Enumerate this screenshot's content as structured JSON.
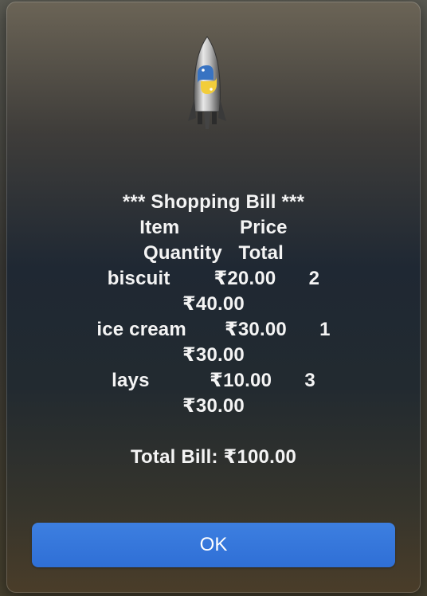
{
  "app_icon": "python-launcher-rocket-icon",
  "message": {
    "lines": [
      "*** Shopping Bill ***",
      "Item           Price",
      "Quantity   Total",
      "biscuit        ₹20.00      2",
      "₹40.00",
      "ice cream       ₹30.00      1",
      "₹30.00",
      "lays           ₹10.00      3",
      "₹30.00",
      "",
      "Total Bill: ₹100.00"
    ]
  },
  "buttons": {
    "ok_label": "OK"
  },
  "colors": {
    "button_blue": "#2f6fd6",
    "text": "#f4f4f4"
  }
}
